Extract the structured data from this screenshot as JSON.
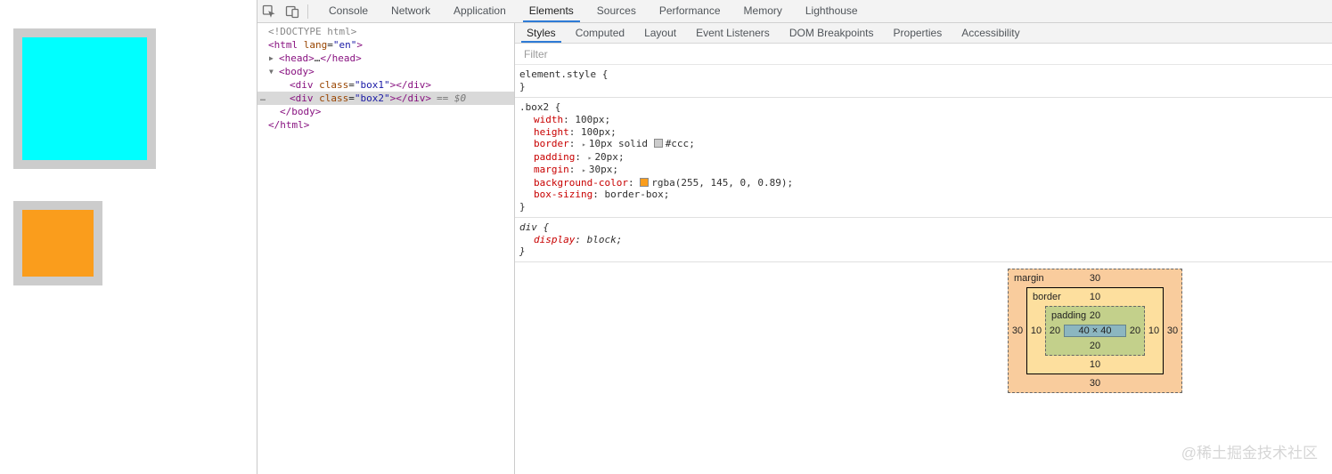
{
  "colors": {
    "accent_blue": "#2e7bd6",
    "box1_fill": "#00ffff",
    "box2_fill": "#fa9d1c",
    "box_border": "#cccccc",
    "selected_row_bg": "#d9d9d9",
    "bm_margin_fill": "#f9cc9d",
    "bm_border_fill": "#fddf9e",
    "bm_padding_fill": "#c3d08b",
    "bm_content_fill": "#8cb6c0",
    "css_swatch_ccc": "#cccccc",
    "css_swatch_bg": "#fa9d1c"
  },
  "glyphs": {
    "collapsed_arrow": "▶",
    "expanded_arrow": "▼",
    "shorthand_arrow": "▸",
    "row_more": "…"
  },
  "toolbar": {
    "tabs": [
      "Console",
      "Network",
      "Application",
      "Elements",
      "Sources",
      "Performance",
      "Memory",
      "Lighthouse"
    ],
    "active_tab": "Elements"
  },
  "dom": {
    "doctype": "<!DOCTYPE html>",
    "html_open": {
      "pre": "<html",
      "attr": " lang",
      "eq": "=",
      "val": "\"en\"",
      "post": ">"
    },
    "head": {
      "open": "<head>",
      "ellipsis": "…",
      "close": "</head>"
    },
    "body_open": "<body>",
    "div1": {
      "pre": "<div",
      "attr": " class",
      "eq": "=",
      "val": "\"box1\"",
      "post": "></div>"
    },
    "div2": {
      "pre": "<div",
      "attr": " class",
      "eq": "=",
      "val": "\"box2\"",
      "post": "></div>",
      "marker": "== $0"
    },
    "body_close": "</body>",
    "html_close": "</html>"
  },
  "styles_panel": {
    "tabs": [
      "Styles",
      "Computed",
      "Layout",
      "Event Listeners",
      "DOM Breakpoints",
      "Properties",
      "Accessibility"
    ],
    "active_tab": "Styles",
    "filter_placeholder": "Filter",
    "punct": {
      "colon": ": ",
      "semi": ";",
      "open_brace": " {",
      "close_brace": "}"
    },
    "rules": [
      {
        "selector": "element.style",
        "props": []
      },
      {
        "selector": ".box2",
        "props": [
          {
            "name": "width",
            "value": "100px"
          },
          {
            "name": "height",
            "value": "100px"
          },
          {
            "name": "border",
            "value": "10px solid ",
            "value_after_swatch": "#ccc",
            "expandable": true
          },
          {
            "name": "padding",
            "value": "20px",
            "expandable": true
          },
          {
            "name": "margin",
            "value": "30px",
            "expandable": true
          },
          {
            "name": "background-color",
            "value": "rgba(255, 145, 0, 0.89)"
          },
          {
            "name": "box-sizing",
            "value": "border-box"
          }
        ]
      },
      {
        "selector": "div",
        "props": [
          {
            "name": "display",
            "value": "block"
          }
        ],
        "user_agent": true
      }
    ]
  },
  "box_model": {
    "margin_label": "margin",
    "border_label": "border",
    "padding_label": "padding",
    "margin": {
      "top": "30",
      "right": "30",
      "bottom": "30",
      "left": "30"
    },
    "border": {
      "top": "10",
      "right": "10",
      "bottom": "10",
      "left": "10"
    },
    "padding": {
      "top": "20",
      "right": "20",
      "bottom": "20",
      "left": "20"
    },
    "content": "40 × 40"
  },
  "watermark": "@稀土掘金技术社区"
}
